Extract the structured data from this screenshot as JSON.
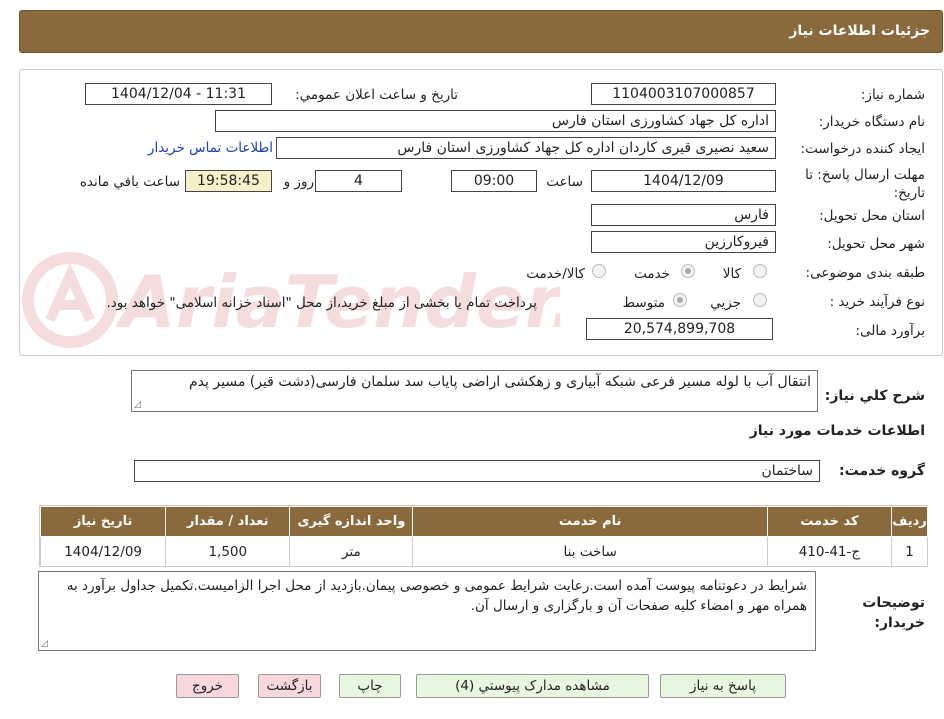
{
  "header": {
    "title": "جزئیات اطلاعات نیاز"
  },
  "form": {
    "need_number_label": "شماره نیاز:",
    "need_number": "1104003107000857",
    "announce_label": "تاریخ و ساعت اعلان عمومي:",
    "announce_value": "1404/12/04 - 11:31",
    "buyer_org_label": "نام دستگاه خريدار:",
    "buyer_org": "اداره کل جهاد کشاورزی استان فارس",
    "creator_label": "ايجاد کننده درخواست:",
    "creator": "سعید نصیری قیری کاردان اداره کل جهاد کشاورزی استان فارس",
    "contact_link": "اطلاعات تماس خريدار",
    "deadline_label": "مهلت ارسال پاسخ: تا تاریخ:",
    "deadline_date": "1404/12/09",
    "time_word": "ساعت",
    "deadline_time": "09:00",
    "days": "4",
    "days_word": "روز و",
    "remaining": "19:58:45",
    "remaining_word": "ساعت باقي مانده",
    "province_label": "استان محل تحويل:",
    "province": "فارس",
    "city_label": "شهر محل تحويل:",
    "city": "فیروکارزین",
    "category_label": "طبقه بندی موضوعی:",
    "category_options": [
      "کالا",
      "خدمت",
      "کالا/خدمت"
    ],
    "category_selected": "خدمت",
    "process_label": "نوع فرآيند خريد :",
    "process_options": [
      "جزيي",
      "متوسط"
    ],
    "process_selected": "متوسط",
    "payment_note": "پرداخت تمام یا بخشی از مبلغ خرید،از محل \"اسناد خزانه اسلامی\" خواهد بود.",
    "estimate_label": "برآورد مالی:",
    "estimate": "20,574,899,708"
  },
  "description": {
    "label": "شرح کلي نياز:",
    "text": "انتقال آب با لوله مسیر فرعی شبکه آبیاری و زهکشی اراضی پایاب سد سلمان فارسی(دشت قیر) مسیر پدم"
  },
  "services": {
    "title": "اطلاعات خدمات مورد نياز",
    "group_label": "گروه خدمت:",
    "group_value": "ساختمان",
    "columns": [
      "ردیف",
      "کد خدمت",
      "نام خدمت",
      "واحد اندازه گیری",
      "تعداد / مقدار",
      "تاریخ نیاز"
    ],
    "rows": [
      {
        "index": "1",
        "code": "ج-41-410",
        "name": "ساخت بنا",
        "unit": "متر",
        "qty": "1,500",
        "date": "1404/12/09"
      }
    ]
  },
  "buyer_notes": {
    "label": "توضيحات خريدار:",
    "text": "شرایط در دعوتنامه پیوست آمده است.رعایت شرایط عمومی و خصوصی پیمان.بازدید از محل اجرا الزامیست.تکمیل جداول برآورد به همراه مهر و امضاء کلیه صفحات آن و بارگزاری و ارسال آن."
  },
  "buttons": {
    "reply": "پاسخ به نیاز",
    "attachments": "مشاهده مدارک پیوستي (4)",
    "print": "چاپ",
    "back": "بازگشت",
    "exit": "خروج"
  },
  "watermark": "AriaTender.net",
  "colors": {
    "header": "#8a6a3c",
    "link": "#1a3fb0",
    "highlight": "#f8f0c8",
    "green_button": "#e8f8e0",
    "pink_button": "#f8d8dc"
  }
}
